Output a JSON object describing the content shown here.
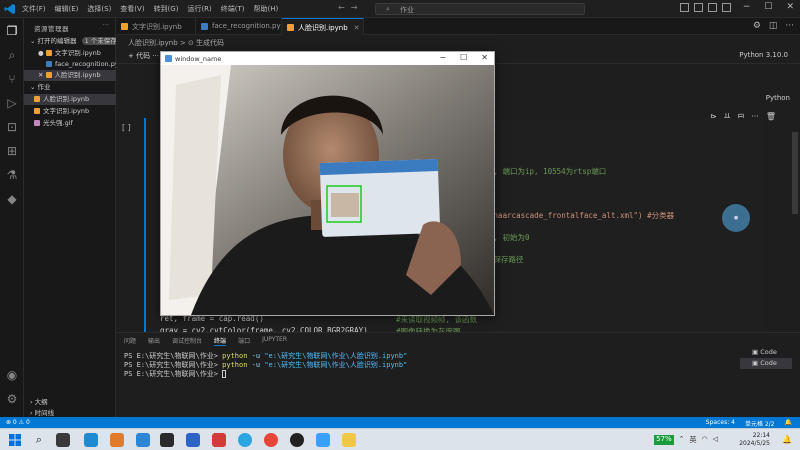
{
  "menu": [
    "文件(F)",
    "编辑(E)",
    "选择(S)",
    "查看(V)",
    "转到(G)",
    "运行(R)",
    "终端(T)",
    "帮助(H)"
  ],
  "command_center": "作业",
  "sidebar": {
    "title": "资源管理器",
    "open_editors": "打开的编辑器",
    "open_editors_badge": "1 个未保存",
    "items": [
      {
        "label": "文字识别.ipynb",
        "color": "#f0a030"
      },
      {
        "label": "face_recognition.py",
        "color": "#3c7bbf"
      },
      {
        "label": "人脸识别.ipynb",
        "color": "#f0a030"
      }
    ],
    "folder": "作业",
    "files": [
      {
        "label": "人脸识别.ipynb",
        "color": "#f0a030"
      },
      {
        "label": "文字识别.ipynb",
        "color": "#f0a030"
      },
      {
        "label": "光头强.gif",
        "color": "#c586c0"
      }
    ],
    "outline": "大纲",
    "timeline": "时间线"
  },
  "tabs": [
    {
      "label": "文字识别.ipynb",
      "color": "#f0a030"
    },
    {
      "label": "face_recognition.py",
      "color": "#3c7bbf"
    },
    {
      "label": "人脸识别.ipynb",
      "color": "#f0a030"
    }
  ],
  "breadcrumb": "人脸识别.ipynb > ⊙ 生成代码",
  "toolbar": {
    "code_label": "+ 代码",
    "more": "···",
    "kernel": "Python 3.10.0"
  },
  "editor": {
    "language": "Python",
    "code": [
      {
        "text": "码, 端口为ip, 10554为rtsp端口",
        "kind": "comment"
      },
      {
        "text": "ta\\haarcascade_frontalface_alt.xml\")  #分类器",
        "kind": "string"
      },
      {
        "text": "脸, 初始为0",
        "kind": "comment"
      },
      {
        "text": "的保存路径",
        "kind": "comment"
      },
      {
        "text": "ret, frame = cap.read()",
        "kind": "code"
      },
      {
        "text": "gray = cv2.cvtColor(frame, cv2.COLOR_BGR2GRAY)",
        "kind": "code"
      }
    ],
    "right_comments": [
      "#来读取视频帧, 该函数",
      "#图像转换为灰度图"
    ]
  },
  "panel": {
    "tabs": [
      "问题",
      "输出",
      "调试控制台",
      "终端",
      "端口",
      "JUPYTER"
    ],
    "active_tab": "终端",
    "lines": [
      {
        "prompt": "PS E:\\研究生\\物联网\\作业> ",
        "cmd": "python",
        "flag": "-u",
        "arg": "\"e:\\研究生\\物联网\\作业\\人脸识别.ipynb\""
      },
      {
        "prompt": "PS E:\\研究生\\物联网\\作业> ",
        "cmd": "python",
        "flag": "-u",
        "arg": "\"e:\\研究生\\物联网\\作业\\人脸识别.ipynb\""
      },
      {
        "prompt": "PS E:\\研究生\\物联网\\作业> ",
        "cmd": "",
        "flag": "",
        "arg": ""
      }
    ],
    "terminals": [
      "Code",
      "Code"
    ]
  },
  "statusbar": {
    "left": "⊗ 0 ⚠ 0",
    "right": [
      "Spaces: 4",
      "单元格 2/2",
      "🔔"
    ]
  },
  "taskbar": {
    "time": "22:14",
    "date": "2024/5/25",
    "battery": "57%",
    "lang": "英"
  },
  "cv_window": {
    "title": "window_name"
  },
  "colors": {
    "accent": "#0078d4",
    "face_box": "#00c800"
  }
}
